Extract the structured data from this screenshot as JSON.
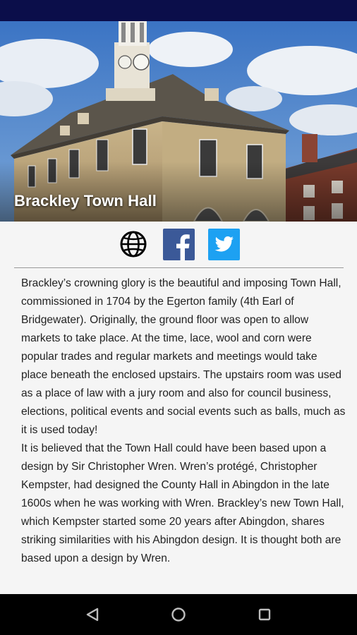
{
  "place": {
    "title": "Brackley Town Hall"
  },
  "social": {
    "website_icon": "globe-icon",
    "facebook_icon": "facebook-icon",
    "twitter_icon": "twitter-icon",
    "facebook_color": "#3b5998",
    "twitter_color": "#1da1f2"
  },
  "content": {
    "paragraph1": "Brackley’s crowning glory is the beautiful and imposing Town Hall, commissioned in 1704 by the Egerton family (4th Earl of Bridgewater). Originally, the ground floor was open to allow markets to take place. At the time, lace, wool and corn were popular trades and regular markets and meetings would take place beneath the enclosed upstairs. The upstairs room was used as a place of law with a jury room and also for council business, elections, political events and social events such as balls, much as it is used today!",
    "paragraph2": "It is believed that the Town Hall could have been based upon a design by Sir Christopher Wren. Wren’s protégé, Christopher Kempster, had designed the County Hall in Abingdon in the late 1600s when he was working with Wren. Brackley’s new Town Hall, which Kempster started some 20 years after Abingdon, shares striking similarities with his Abingdon design. It is thought both are based upon a design by Wren."
  },
  "navigation": {
    "back_icon": "back-triangle-icon",
    "home_icon": "home-circle-icon",
    "recents_icon": "recents-square-icon"
  },
  "colors": {
    "status_bar": "#0b0e4a",
    "nav_bar": "#000000",
    "background": "#f5f5f5"
  }
}
